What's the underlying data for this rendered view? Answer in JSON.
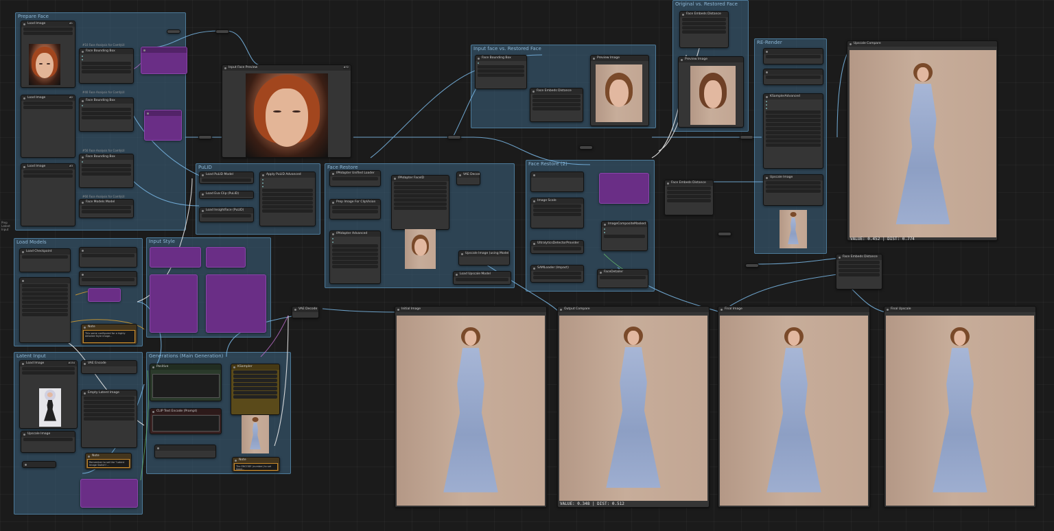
{
  "groups": {
    "prepare_face": "Prepare Face",
    "load_models": "Load Models",
    "latent_input": "Latent Input",
    "pulid": "PuLID",
    "input_style": "Input Style",
    "face_restore": "Face Restore",
    "generations": "Generations (Main Generation)",
    "input_face_vs_restored": "Input face vs. Restored Face",
    "face_restore_2": "Face Restore (2)",
    "original_vs_restored": "Original vs. Restored Face",
    "re_render": "RE-Render"
  },
  "nodes": {
    "load_image_1": {
      "title": "Load Image",
      "badge": "#1"
    },
    "load_image_2": {
      "title": "Load Image",
      "badge": "#2"
    },
    "load_image_3": {
      "title": "Load Image",
      "badge": "#3"
    },
    "load_image_latent": {
      "title": "Load Image",
      "badge": "#154"
    },
    "face_bounding_1": {
      "title": "Face Bounding Box"
    },
    "face_bounding_2": {
      "title": "Face Bounding Box"
    },
    "face_bounding_3": {
      "title": "Face Bounding Box"
    },
    "face_analysis_1": "#10 Face Analysis for ComfyUI",
    "face_analysis_2": "#40 Face Analysis for ComfyUI",
    "face_analysis_3": "#50 Face Analysis for ComfyUI",
    "face_analysis_4": "#60 Face Analysis for ComfyUI",
    "face_models_model": "Face Models Model",
    "input_face_preview": {
      "title": "Input Face Preview",
      "badge": "#72"
    },
    "pulid_model": "Load PuLID Model",
    "apply_pulid": "Apply PuLID Advanced",
    "eva_clip": "Load Eva Clip (PuLID)",
    "insightface": "Load InsightFace (PuLID)",
    "load_checkpoint": "Load Checkpoint",
    "clip_text_encode": "CLIP Text Encode (Prompt)",
    "ksampler": "KSampler",
    "positive": "Positive",
    "vae_decode": "VAE Decode",
    "face_restore_preview": "Face Restore",
    "ipadapter_unified": "IPAdapter Unified Loader",
    "ipadapter_faceid": "IPAdapter FaceID",
    "ipadapter_advanced": "IPAdapter Advanced",
    "prep_image_clipvision": "Prep Image For ClipVision",
    "upscale_model": "Load Upscale Model",
    "upscale_with_model": "Upscale Image (using Model)",
    "image_scale": "Image Scale",
    "ultralytics": "UltralyticsDetectorProvider",
    "sam_loader": "SAMLoader (Impact)",
    "face_detailer": "FaceDetailer",
    "image_composite": "ImageCompositeMasked",
    "face_embeds_distance": "Face Embeds Distance",
    "ksampler_adv": "KSamplerAdvanced",
    "preview_image_1": "Preview Image",
    "preview_image_2": "Preview Image",
    "image_compare": "Image Compare",
    "note_1": "Note",
    "note_2": "Note",
    "note_3": "Note",
    "vae_encode": "VAE Encode",
    "empty_latent": "Empty Latent Image",
    "upscale_node": "Upscale Image",
    "initial_image": "Initial Image",
    "output_compare": "Output Compare",
    "final_image": "Final Image",
    "final_upscale": "Final Upscale",
    "upscale_compare": "Upscale Compare"
  },
  "readouts": {
    "compare_top": "VALUE: 0.452 | DIST: 0.774",
    "compare_bottom": "VALUE: 0.348 | DIST: 0.512"
  },
  "notes": {
    "note_1_text": "This some configured for a highly detailed Style image...",
    "note_2_text": "Remember to set the \"Latent Image Switch\"...",
    "note_3_text": "The ENCODE (number) to set Seed..."
  },
  "side_text": "Prep\nLatent\nInput",
  "colors": {
    "group_bg": "#3c6482",
    "node_bg": "#353535",
    "purple_node": "#6a2e86",
    "wire_blue": "#7ab8e6",
    "wire_white": "#e8e8e8",
    "canvas_bg": "#1b1b1b"
  }
}
